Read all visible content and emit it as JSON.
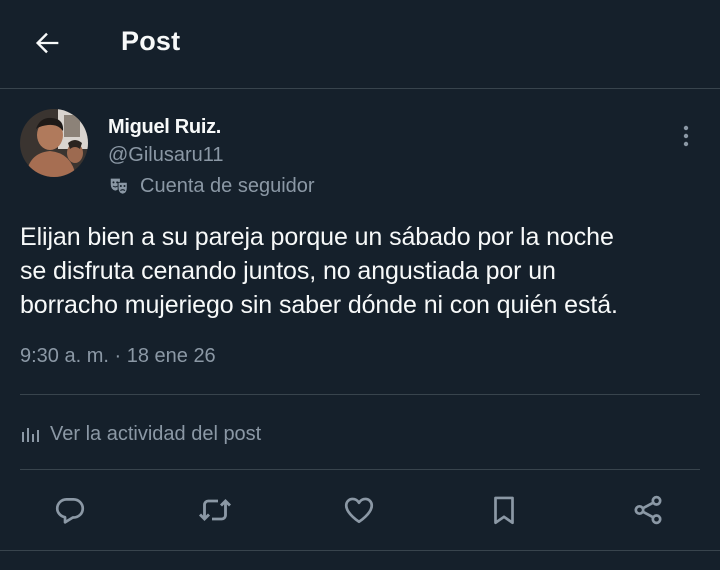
{
  "header": {
    "title": "Post",
    "back_icon": "arrow-left-icon"
  },
  "post": {
    "author": {
      "display_name": "Miguel Ruiz.",
      "handle": "@Gilusaru11",
      "badge_icon": "theater-masks-icon",
      "badge_text": "Cuenta de seguidor"
    },
    "text": "Elijan bien a su pareja porque un sábado por la noche\nse disfruta cenando juntos, no angustiada por un\nborracho mujeriego sin saber dónde ni con quién está.",
    "timestamp": "9:30 a. m. · 18 ene 26",
    "activity_label": "Ver la actividad del post"
  },
  "actions": [
    "reply-icon",
    "repost-icon",
    "like-icon",
    "bookmark-icon",
    "share-icon"
  ],
  "colors": {
    "background": "#15202b",
    "text": "#f7f9f9",
    "secondary": "#8b98a5",
    "border": "#38444d"
  }
}
